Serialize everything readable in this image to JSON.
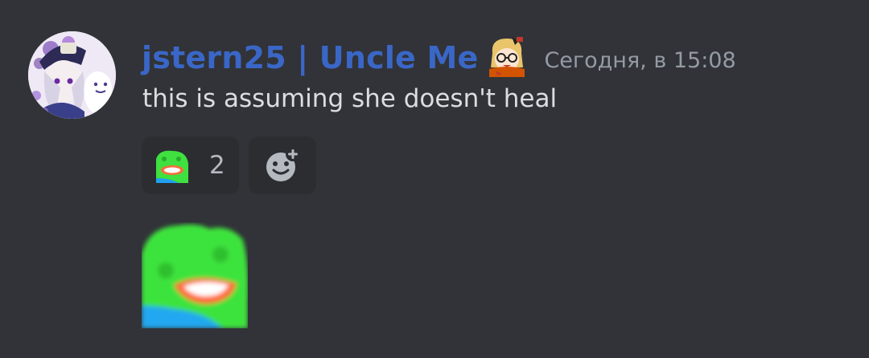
{
  "message": {
    "author": "jstern25 | Uncle Me",
    "timestamp": "Сегодня, в 15:08",
    "content": "this is assuming she doesn't heal",
    "role_icon": "anime-girl-glasses-icon",
    "avatar": "anime-girl-avatar-icon"
  },
  "reactions": [
    {
      "emoji": "pepe-laugh-emoji",
      "count": "2"
    }
  ],
  "add_reaction": {
    "icon": "add-reaction-icon"
  },
  "standalone_emoji": "pepe-laugh-emoji",
  "colors": {
    "background": "#313338",
    "username": "#3a67c7",
    "text": "#dbdee1",
    "timestamp": "#949ba4",
    "reaction_bg": "#2b2d31"
  }
}
